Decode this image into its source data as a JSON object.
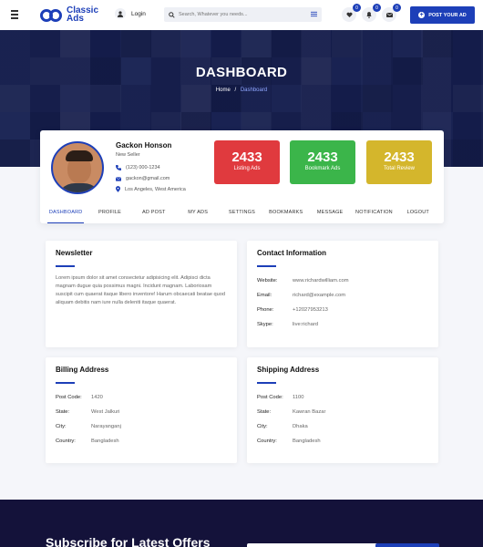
{
  "header": {
    "logo_line1": "Classic",
    "logo_line2": "Ads",
    "login_label": "Login",
    "search_placeholder": "Search, Whatever you needs...",
    "favorites_count": "0",
    "notifications_count": "0",
    "messages_count": "0",
    "post_label": "POST YOUR AD"
  },
  "hero": {
    "title": "DASHBOARD",
    "breadcrumb_home": "Home",
    "breadcrumb_separator": "/",
    "breadcrumb_current": "Dashboard"
  },
  "profile": {
    "name": "Gackon Honson",
    "role": "New Seller",
    "phone": "(123) 000-1234",
    "email": "gackon@gmail.com",
    "location": "Los Angeles, West America"
  },
  "stats": [
    {
      "value": "2433",
      "label": "Listing Ads",
      "color": "#e03a3e"
    },
    {
      "value": "2433",
      "label": "Bookmark Ads",
      "color": "#3bb54a"
    },
    {
      "value": "2433",
      "label": "Total Review",
      "color": "#d4b62c"
    }
  ],
  "tabs": [
    "DASHBOARD",
    "PROFILE",
    "AD POST",
    "MY ADS",
    "SETTINGS",
    "BOOKMARKS",
    "MESSAGE",
    "NOTIFICATION",
    "LOGOUT"
  ],
  "newsletter": {
    "title": "Newsletter",
    "text": "Lorem ipsum dolor sit amet consectetur adipisicing elit. Adipisci dicta magnam dugue quia possimus magni. Incidunt magnam. Laboriosam suscipit cum quaerat itaque libero inventore! Harum obcaecati beatae quod aliquam debitis nam iure nulla deleniti itaque quaerat."
  },
  "contact": {
    "title": "Contact Information",
    "rows": [
      {
        "key": "Website:",
        "value": "www.richardwilliam.com"
      },
      {
        "key": "Email:",
        "value": "richard@example.com"
      },
      {
        "key": "Phone:",
        "value": "+12027953213"
      },
      {
        "key": "Skype:",
        "value": "live:richard"
      }
    ]
  },
  "billing": {
    "title": "Billing Address",
    "rows": [
      {
        "key": "Post Code:",
        "value": "1420"
      },
      {
        "key": "State:",
        "value": "West Jalkuri"
      },
      {
        "key": "City:",
        "value": "Narayanganj"
      },
      {
        "key": "Country:",
        "value": "Bangladesh"
      }
    ]
  },
  "shipping": {
    "title": "Shipping Address",
    "rows": [
      {
        "key": "Post Code:",
        "value": "1100"
      },
      {
        "key": "State:",
        "value": "Kawran Bazar"
      },
      {
        "key": "City:",
        "value": "Dhaka"
      },
      {
        "key": "Country:",
        "value": "Bangladesh"
      }
    ]
  },
  "footer": {
    "subscribe_title": "Subscribe for Latest Offers"
  },
  "colors": {
    "brand": "#1d3fb8",
    "footer_bg": "#14123a"
  }
}
